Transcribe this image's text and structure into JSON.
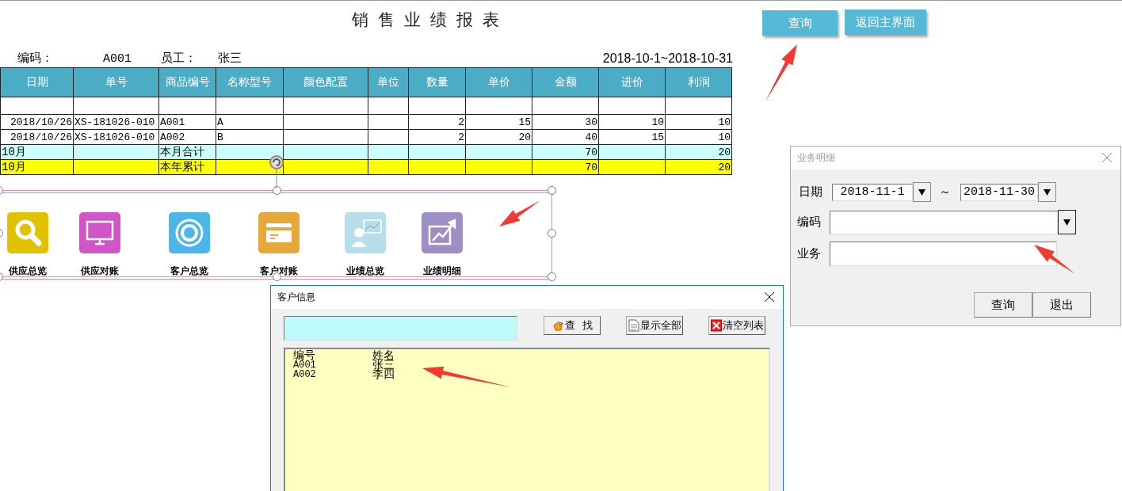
{
  "sheet": {
    "title": "销售业绩报表",
    "code_label": "编码：",
    "code": "A001",
    "employee_label": "员工：",
    "employee": "张三",
    "period": "2018-10-1~2018-10-31",
    "table": {
      "columns": [
        "日期",
        "单号",
        "商品编号",
        "名称型号",
        "颜色配置",
        "单位",
        "数量",
        "单价",
        "金额",
        "进价",
        "利润"
      ],
      "rows": [
        {
          "kind": "blank",
          "cells": [
            null,
            null,
            null,
            null,
            null,
            null,
            null,
            null,
            null,
            null,
            null
          ]
        },
        {
          "kind": "detail",
          "cells": [
            "2018/10/26",
            "XS-181026-010",
            "A001",
            "A",
            null,
            null,
            "2",
            "15",
            "30",
            "10",
            "10"
          ]
        },
        {
          "kind": "detail",
          "cells": [
            "2018/10/26",
            "XS-181026-010",
            "A002",
            "B",
            null,
            null,
            "2",
            "20",
            "40",
            "15",
            "10"
          ]
        },
        {
          "kind": "month_total",
          "cells": [
            "10月",
            null,
            "本月合计",
            null,
            null,
            null,
            null,
            null,
            "70",
            null,
            "20"
          ]
        },
        {
          "kind": "year_total",
          "cells": [
            "10月",
            null,
            "本年累计",
            null,
            null,
            null,
            null,
            null,
            "70",
            null,
            "20"
          ]
        }
      ]
    }
  },
  "shortcuts": [
    {
      "label": "供应总览",
      "color": "#e0c300"
    },
    {
      "label": "供应对账",
      "color": "#cf55c9"
    },
    {
      "label": "客户总览",
      "color": "#4bb7e8"
    },
    {
      "label": "客户对账",
      "color": "#e7a83b"
    },
    {
      "label": "业绩总览",
      "color": "#b5dfea"
    },
    {
      "label": "业绩明细",
      "color": "#9d8fc5"
    }
  ],
  "top_buttons": [
    "查询",
    "返回主界面"
  ],
  "detail_dialog": {
    "title": "业务明细",
    "active": false,
    "date_label": "日期",
    "date_from": "2018-11-1",
    "separator": "～",
    "date_to": "2018-11-30",
    "code_label": "编码",
    "business_label": "业务",
    "buttons": [
      "查询",
      "退出"
    ]
  },
  "customer_dialog": {
    "title": "客户信息",
    "active": true,
    "buttons": [
      "查  找",
      "显示全部",
      "清空列表"
    ],
    "list": [
      {
        "code": "编号",
        "name": "姓名"
      },
      {
        "code": "A001",
        "name": "张三"
      },
      {
        "code": "A002",
        "name": "李四"
      }
    ]
  }
}
